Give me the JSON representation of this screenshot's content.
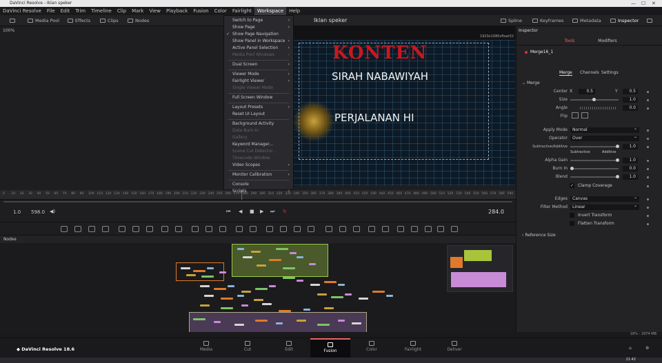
{
  "window": {
    "title": "DaVinci Resolve - Iklan speker"
  },
  "menu": [
    "DaVinci Resolve",
    "File",
    "Edit",
    "Trim",
    "Timeline",
    "Clip",
    "Mark",
    "View",
    "Playback",
    "Fusion",
    "Color",
    "Fairlight",
    "Workspace",
    "Help"
  ],
  "toolbar": {
    "media_pool": "Media Pool",
    "effects": "Effects",
    "clips": "Clips",
    "nodes": "Nodes",
    "project_name": "Iklan speker",
    "spline": "Spline",
    "keyframes": "Keyframes",
    "metadata": "Metadata",
    "inspector": "Inspector"
  },
  "viewer": {
    "zoom": "100%",
    "resolution": "1920x1080xfloat32",
    "title_text": "KONTEN",
    "line1": "SIRAH NABAWIYAH",
    "line2": "PERJALANAN HI"
  },
  "workspace_menu": [
    {
      "label": "Switch to Page",
      "arrow": true
    },
    {
      "label": "Show Page",
      "arrow": true
    },
    {
      "label": "Show Page Navigation",
      "checked": true
    },
    {
      "label": "Show Panel in Workspace",
      "arrow": true
    },
    {
      "label": "Active Panel Selection",
      "arrow": true
    },
    {
      "label": "Media Pool Windows",
      "disabled": true,
      "arrow": true
    },
    {
      "sep": true
    },
    {
      "label": "Dual Screen",
      "arrow": true
    },
    {
      "sep": true
    },
    {
      "label": "Viewer Mode",
      "arrow": true
    },
    {
      "label": "Fairlight Viewer",
      "arrow": true
    },
    {
      "label": "Single Viewer Mode",
      "disabled": true
    },
    {
      "sep": true
    },
    {
      "label": "Full Screen Window"
    },
    {
      "sep": true
    },
    {
      "label": "Layout Presets",
      "arrow": true
    },
    {
      "label": "Reset UI Layout"
    },
    {
      "sep": true
    },
    {
      "label": "Background Activity"
    },
    {
      "label": "Data Burn-in",
      "disabled": true
    },
    {
      "label": "Gallery",
      "disabled": true
    },
    {
      "label": "Keyword Manager..."
    },
    {
      "label": "Scene Cut Detector...",
      "disabled": true
    },
    {
      "label": "Timecode Window",
      "disabled": true
    },
    {
      "label": "Video Scopes",
      "arrow": true
    },
    {
      "sep": true
    },
    {
      "label": "Monitor Calibration",
      "arrow": true
    },
    {
      "sep": true
    },
    {
      "label": "Console"
    },
    {
      "label": "Scripts",
      "arrow": true
    }
  ],
  "timeline": {
    "ticks": [
      "0",
      "10",
      "20",
      "30",
      "40",
      "50",
      "60",
      "70",
      "80",
      "90",
      "100",
      "110",
      "120",
      "130",
      "140",
      "150",
      "160",
      "170",
      "180",
      "190",
      "200",
      "210",
      "220",
      "230",
      "240",
      "250",
      "260",
      "270",
      "280",
      "290",
      "300",
      "310",
      "320",
      "330",
      "340",
      "350",
      "360",
      "370",
      "380",
      "390",
      "400",
      "410",
      "420",
      "430",
      "440",
      "450",
      "460",
      "470",
      "480",
      "490",
      "500",
      "510",
      "520",
      "530",
      "540",
      "550",
      "560",
      "570",
      "580",
      "590"
    ],
    "start": "1.0",
    "end": "598.0",
    "current": "284.0"
  },
  "nodes_label": "Nodes",
  "inspector": {
    "title": "Inspector",
    "tabs": [
      "Tools",
      "Modifiers"
    ],
    "node_name": "Merge16_1",
    "subtabs": [
      "Merge",
      "Channels",
      "Settings"
    ],
    "section": "Merge",
    "center_label": "Center",
    "center_x_label": "X",
    "center_x": "0.5",
    "center_y_label": "Y",
    "center_y": "0.5",
    "size_label": "Size",
    "size": "1.0",
    "angle_label": "Angle",
    "angle": "0.0",
    "flip_label": "Flip",
    "apply_mode_label": "Apply Mode",
    "apply_mode": "Normal",
    "operator_label": "Operator",
    "operator": "Over",
    "sub_add_label": "Subtractive/Additive",
    "sub_add": "1.0",
    "subtractive": "Subtractive",
    "additive": "Additive",
    "alpha_gain_label": "Alpha Gain",
    "alpha_gain": "1.0",
    "burn_in_label": "Burn In",
    "burn_in": "0.0",
    "blend_label": "Blend",
    "blend": "1.0",
    "clamp_coverage": "Clamp Coverage",
    "edges_label": "Edges",
    "edges": "Canvas",
    "filter_label": "Filter Method",
    "filter": "Linear",
    "invert_transform": "Invert Transform",
    "flatten_transform": "Flatten Transform",
    "reference_size": "Reference Size"
  },
  "status": {
    "memory": "18% - 2974 MB"
  },
  "pages": [
    "Media",
    "Cut",
    "Edit",
    "Fusion",
    "Color",
    "Fairlight",
    "Deliver"
  ],
  "app_name": "DaVinci Resolve 18.6",
  "clock": "21:42",
  "colors": {
    "accent": "#e66",
    "konten_red": "#c8181e",
    "selected_node": "#e07a2a"
  }
}
